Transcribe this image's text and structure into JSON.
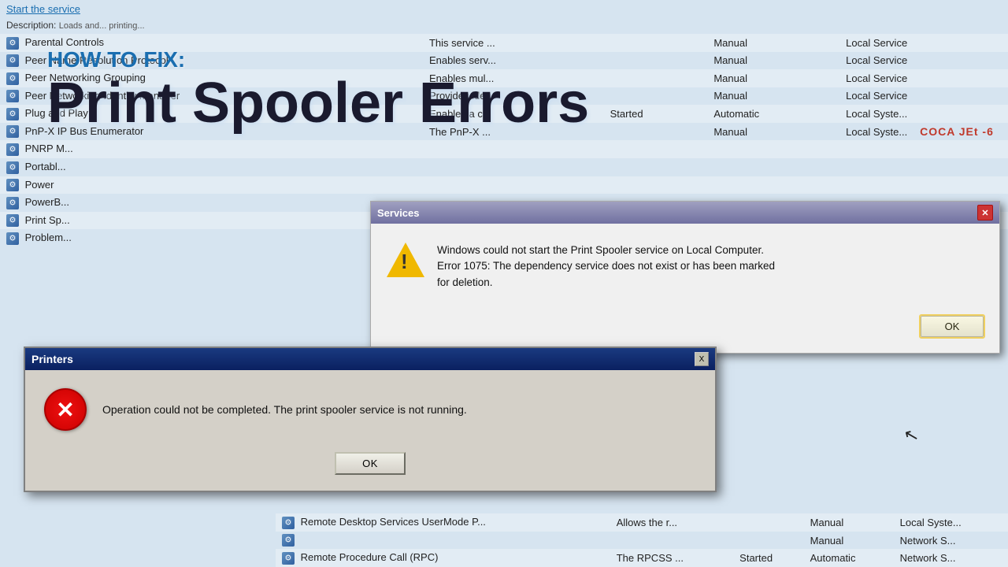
{
  "background": {
    "color": "#c8daea"
  },
  "overlay_title": {
    "how_to_fix": "HOW TO FIX:",
    "main_title": "Print Spooler Errors"
  },
  "services_table": {
    "rows": [
      {
        "name": "Parental Controls",
        "description": "This service ...",
        "status": "",
        "startup": "Manual",
        "log_on": "Local Service"
      },
      {
        "name": "Peer Name Resolution Protocol",
        "description": "Enables serv...",
        "status": "",
        "startup": "Manual",
        "log_on": "Local Service"
      },
      {
        "name": "Peer Networking Grouping",
        "description": "Enables mul...",
        "status": "",
        "startup": "Manual",
        "log_on": "Local Service"
      },
      {
        "name": "Peer Networking Identity Manager",
        "description": "Provides ide...",
        "status": "",
        "startup": "Manual",
        "log_on": "Local Service"
      },
      {
        "name": "Plug and Play",
        "description": "Enables a c...",
        "status": "Started",
        "startup": "Automatic",
        "log_on": "Local Syste..."
      },
      {
        "name": "PnP-X IP Bus Enumerator",
        "description": "The PnP-X ...",
        "status": "",
        "startup": "Manual",
        "log_on": "Local Syste..."
      },
      {
        "name": "PNRP M...",
        "description": "",
        "status": "",
        "startup": "",
        "log_on": ""
      },
      {
        "name": "Portabl...",
        "description": "",
        "status": "",
        "startup": "",
        "log_on": ""
      },
      {
        "name": "Power",
        "description": "",
        "status": "",
        "startup": "",
        "log_on": ""
      },
      {
        "name": "PowerB...",
        "description": "",
        "status": "",
        "startup": "",
        "log_on": ""
      },
      {
        "name": "Print Sp...",
        "description": "",
        "status": "",
        "startup": "",
        "log_on": ""
      },
      {
        "name": "Problem...",
        "description": "",
        "status": "",
        "startup": "",
        "log_on": ""
      }
    ]
  },
  "services_dialog": {
    "title": "Services",
    "close_label": "✕"
  },
  "error_dialog": {
    "title": "Services",
    "message_line1": "Windows could not start the Print Spooler service on Local Computer.",
    "message_line2": "Error 1075: The dependency service does not exist or has been marked",
    "message_line3": "for deletion.",
    "ok_label": "OK",
    "close_label": "✕"
  },
  "printers_dialog": {
    "title": "Printers",
    "message": "Operation could not be completed. The print spooler service is not running.",
    "ok_label": "OK",
    "close_label": "X"
  },
  "bottom_rows": [
    {
      "name": "Remote Desktop Services UserMode P...",
      "description": "Allows the r...",
      "status": "",
      "startup": "Manual",
      "log_on": "Local Syste..."
    },
    {
      "name": "",
      "description": "",
      "status": "",
      "startup": "Manual",
      "log_on": "Network S..."
    },
    {
      "name": "Remote Procedure Call (RPC)",
      "description": "The RPCSS ...",
      "status": "Started",
      "startup": "Automatic",
      "log_on": "Network S..."
    }
  ],
  "watermark": {
    "text": "COCA JEt -6"
  },
  "top_link": {
    "text": "Start the service"
  },
  "top_description": {
    "text": "Description:"
  }
}
